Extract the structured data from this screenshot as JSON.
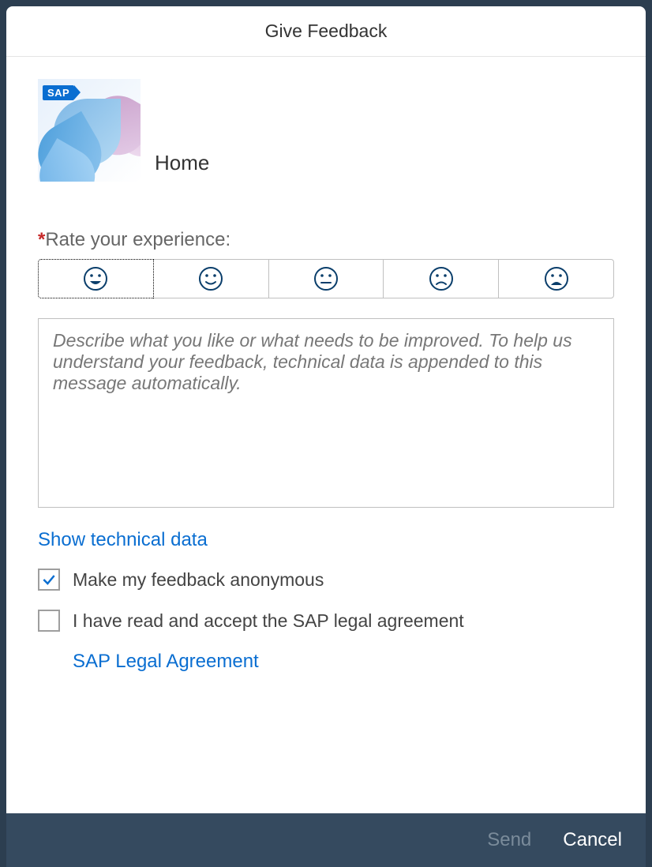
{
  "dialog": {
    "title": "Give Feedback",
    "app_name": "Home",
    "sap_badge": "SAP",
    "rate_label": "Rate your experience:",
    "textarea_placeholder": "Describe what you like or what needs to be improved. To help us understand your feedback, technical data is appended to this message automatically.",
    "show_technical_data": "Show technical data",
    "anonymous_label": "Make my feedback anonymous",
    "anonymous_checked": true,
    "legal_accept_label": "I have read and accept the SAP legal agreement",
    "legal_accept_checked": false,
    "legal_link": "SAP Legal Agreement",
    "send_label": "Send",
    "cancel_label": "Cancel",
    "ratings": [
      {
        "name": "very-happy",
        "selected": true
      },
      {
        "name": "happy",
        "selected": false
      },
      {
        "name": "neutral",
        "selected": false
      },
      {
        "name": "sad",
        "selected": false
      },
      {
        "name": "very-sad",
        "selected": false
      }
    ]
  }
}
